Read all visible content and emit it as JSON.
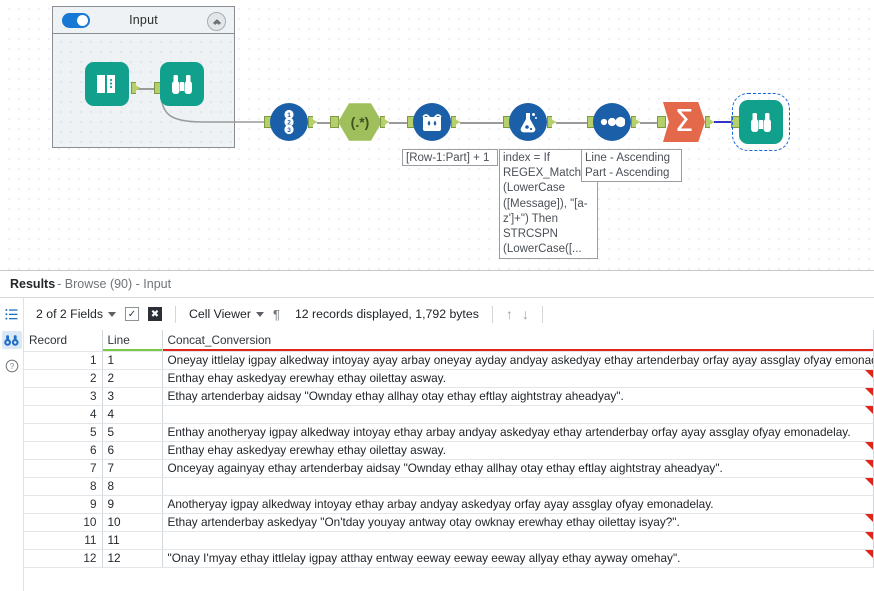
{
  "canvas": {
    "container": {
      "title": "Input",
      "toggle_on": true,
      "collapse_icon": "collapse-chevron-icon"
    },
    "nodes": [
      {
        "id": "input-data",
        "icon": "input-data-book-icon",
        "type": "square-teal"
      },
      {
        "id": "browse-1",
        "icon": "browse-binoculars-icon",
        "type": "square-teal"
      },
      {
        "id": "record-id",
        "icon": "record-id-123-icon",
        "type": "circle-blue"
      },
      {
        "id": "regex",
        "icon": "regex-parse-icon",
        "type": "hex-green",
        "glyph": "(.*)"
      },
      {
        "id": "multi-row",
        "icon": "multi-row-formula-icon",
        "type": "circle-blue"
      },
      {
        "id": "formula",
        "icon": "formula-flask-icon",
        "type": "circle-blue"
      },
      {
        "id": "sort",
        "icon": "sort-dots-icon",
        "type": "circle-blue"
      },
      {
        "id": "summarize",
        "icon": "summarize-sigma-icon",
        "type": "sigma-orange",
        "glyph": "Σ"
      },
      {
        "id": "browse-final",
        "icon": "browse-binoculars-icon",
        "type": "square-teal",
        "selected": true
      }
    ],
    "annotations": [
      {
        "id": "multi-row-annot",
        "text": "[Row-1:Part] + 1"
      },
      {
        "id": "formula-annot",
        "text": "index = If REGEX_Match (LowerCase ([Message]), \"[a-z']+\") Then STRCSPN (LowerCase([..."
      },
      {
        "id": "sort-annot",
        "text": "Line - Ascending\nPart - Ascending"
      }
    ]
  },
  "results": {
    "title_bold": "Results",
    "title_rest": " - Browse (90) - Input",
    "rail": [
      {
        "name": "list-view-icon",
        "glyph": "☰",
        "active": false
      },
      {
        "name": "browse-binoculars-icon",
        "glyph": "⚭",
        "active": true
      },
      {
        "name": "help-icon",
        "glyph": "?",
        "active": false
      }
    ],
    "toolbar": {
      "fields_label": "2 of 2 Fields",
      "select_all_icon": "checkbox-check-icon",
      "deselect_all_icon": "checkbox-x-icon",
      "viewer_label": "Cell Viewer",
      "pilcrow_icon": "pilcrow-icon",
      "record_count": "12 records displayed, 1,792 bytes",
      "up_arrow": "↑",
      "down_arrow": "↓"
    },
    "table": {
      "columns": [
        {
          "key": "record",
          "label": "Record",
          "underline": "#ffffff"
        },
        {
          "key": "line",
          "label": "Line",
          "underline": "#7ac943"
        },
        {
          "key": "value",
          "label": "Concat_Conversion",
          "underline": "#e1251b"
        }
      ],
      "rows": [
        {
          "record": "1",
          "line": "1",
          "value": "Oneyay ittlelay igpay alkedway intoyay ayay arbay oneyay ayday andyay askedyay ethay artenderbay orfay ayay assglay ofyay emonadelay.",
          "indent": false,
          "marker": false
        },
        {
          "record": "2",
          "line": "2",
          "value": "Enthay ehay askedyay erewhay ethay oilettay asway.",
          "indent": true,
          "marker": true
        },
        {
          "record": "3",
          "line": "3",
          "value": "Ethay artenderbay aidsay \"Ownday ethay allhay otay ethay eftlay aightstray aheadyay\".",
          "indent": true,
          "marker": true
        },
        {
          "record": "4",
          "line": "4",
          "value": "",
          "indent": false,
          "marker": true
        },
        {
          "record": "5",
          "line": "5",
          "value": "Enthay anotheryay igpay alkedway intoyay ethay arbay andyay askedyay ethay artenderbay orfay ayay assglay ofyay emonadelay.",
          "indent": false,
          "marker": false
        },
        {
          "record": "6",
          "line": "6",
          "value": "Enthay ehay askedyay erewhay ethay oilettay asway.",
          "indent": true,
          "marker": true
        },
        {
          "record": "7",
          "line": "7",
          "value": "Onceyay againyay ethay artenderbay aidsay \"Ownday ethay allhay otay ethay eftlay aightstray aheadyay\".",
          "indent": true,
          "marker": true
        },
        {
          "record": "8",
          "line": "8",
          "value": "",
          "indent": false,
          "marker": true
        },
        {
          "record": "9",
          "line": "9",
          "value": "Anotheryay igpay alkedway intoyay ethay arbay andyay askedyay orfay ayay assglay ofyay emonadelay.",
          "indent": false,
          "marker": false
        },
        {
          "record": "10",
          "line": "10",
          "value": "Ethay artenderbay askedyay \"On'tday youyay antway otay owknay erewhay ethay oilettay isyay?\".",
          "indent": true,
          "marker": true
        },
        {
          "record": "11",
          "line": "11",
          "value": "",
          "indent": false,
          "marker": true
        },
        {
          "record": "12",
          "line": "12",
          "value": "\"Onay I'myay ethay ittlelay igpay atthay entway eeway eeway eeway allyay ethay ayway omehay\".",
          "indent": false,
          "marker": true
        }
      ]
    }
  },
  "colors": {
    "teal": "#11a08c",
    "blue_node": "#1b5fa8",
    "green_hex": "#9fbf5c",
    "orange_sigma": "#e4694a",
    "accent_link": "#1f6fc4",
    "marker_red": "#e1251b",
    "underline_green": "#7ac943"
  }
}
